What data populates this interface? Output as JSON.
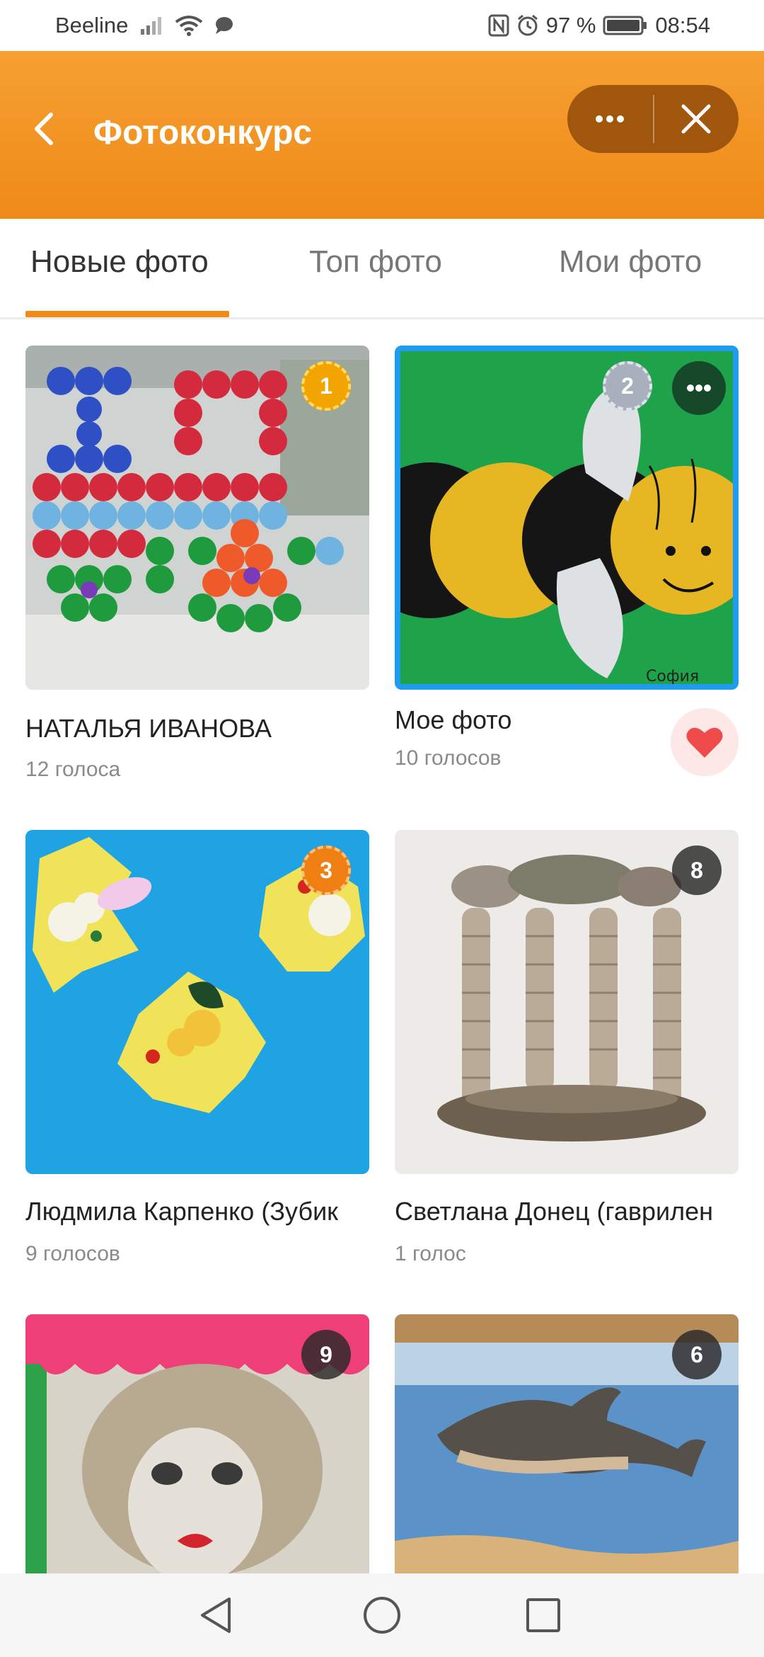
{
  "status_bar": {
    "carrier": "Beeline",
    "battery": "97 %",
    "time": "08:54"
  },
  "header": {
    "title": "Фотоконкурс"
  },
  "tabs": [
    {
      "label": "Новые фото",
      "active": true
    },
    {
      "label": "Топ фото",
      "active": false
    },
    {
      "label": "Мои фото",
      "active": false
    }
  ],
  "photos": [
    {
      "name": "НАТАЛЬЯ ИВАНОВА",
      "votes": "12 голоса",
      "rank": "1"
    },
    {
      "name": "Мое фото",
      "votes": "10 голосов",
      "rank": "2",
      "liked": true
    },
    {
      "name": "Людмила Карпенко (Зубик",
      "votes": "9 голосов",
      "rank": "3"
    },
    {
      "name": "Светлана Донец (гаврилен",
      "votes": "1 голос",
      "rank": "8"
    },
    {
      "name": "",
      "votes": "",
      "rank": "9"
    },
    {
      "name": "",
      "votes": "",
      "rank": "6"
    }
  ],
  "colors": {
    "header_top": "#f5a033",
    "header_bottom": "#ef8a17",
    "accent": "#ef8a17",
    "selected_border": "#1f9cf0",
    "like": "#ef4b4b"
  },
  "icons": [
    "back-arrow-icon",
    "more-icon",
    "close-icon",
    "heart-icon",
    "nav-back-icon",
    "nav-home-icon",
    "nav-recents-icon"
  ]
}
